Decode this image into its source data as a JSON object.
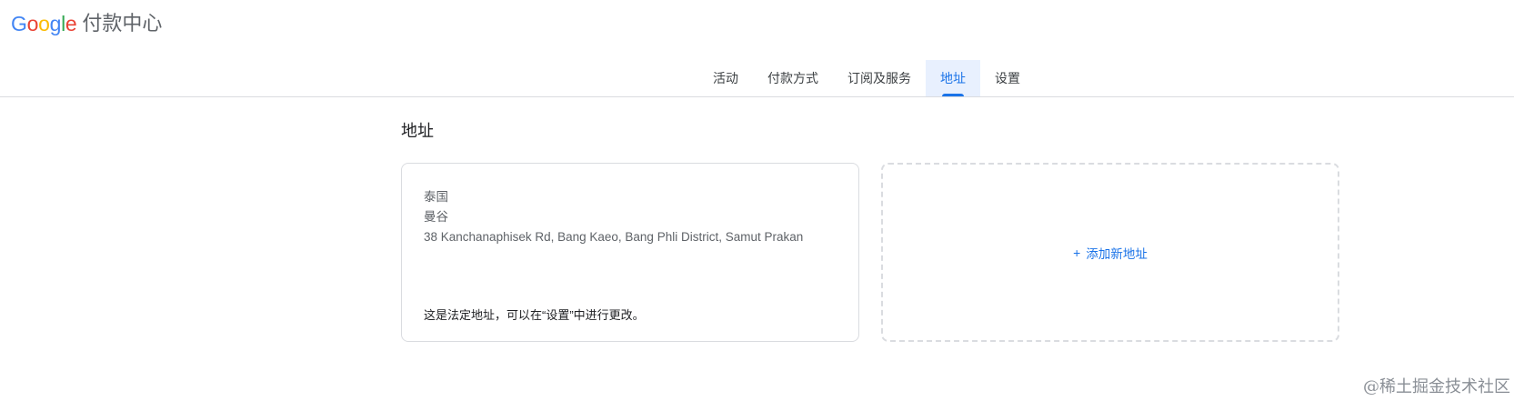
{
  "header": {
    "logo_letters": [
      {
        "char": "G",
        "color": "#4285F4"
      },
      {
        "char": "o",
        "color": "#EA4335"
      },
      {
        "char": "o",
        "color": "#FBBC05"
      },
      {
        "char": "g",
        "color": "#4285F4"
      },
      {
        "char": "l",
        "color": "#34A853"
      },
      {
        "char": "e",
        "color": "#EA4335"
      }
    ],
    "product_name": "付款中心"
  },
  "tabs": [
    {
      "label": "活动",
      "active": false
    },
    {
      "label": "付款方式",
      "active": false
    },
    {
      "label": "订阅及服务",
      "active": false
    },
    {
      "label": "地址",
      "active": true
    },
    {
      "label": "设置",
      "active": false
    }
  ],
  "main": {
    "title": "地址",
    "address_card": {
      "lines": [
        "泰国",
        "曼谷",
        "38 Kanchanaphisek Rd, Bang Kaeo, Bang Phli District, Samut Prakan"
      ],
      "legal_note": "这是法定地址，可以在“设置”中进行更改。"
    },
    "add_card": {
      "icon": "plus-icon",
      "icon_glyph": "+",
      "label": "添加新地址"
    }
  },
  "watermark": "@稀土掘金技术社区",
  "colors": {
    "accent": "#1a73e8",
    "active_tab_bg": "#e8f0fe",
    "border": "#dadce0"
  }
}
